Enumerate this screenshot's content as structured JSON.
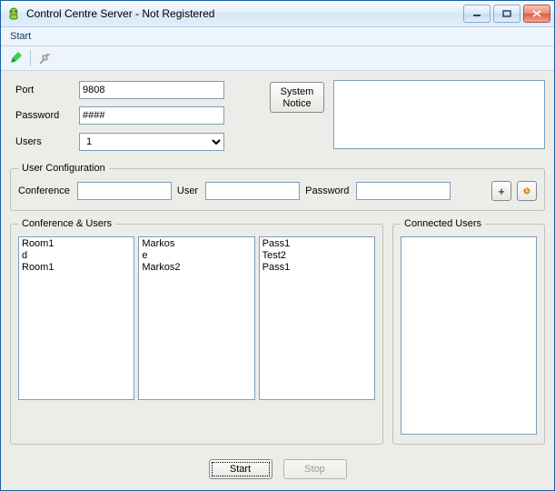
{
  "window": {
    "title": "Control Centre Server - Not Registered"
  },
  "menu": {
    "start": "Start"
  },
  "toolbar": {
    "connect_icon": "pen-icon",
    "disconnect_icon": "unplug-icon"
  },
  "settings": {
    "port_label": "Port",
    "port_value": "9808",
    "password_label": "Password",
    "password_value": "####",
    "users_label": "Users",
    "users_value": "1"
  },
  "system_notice": {
    "button_line1": "System",
    "button_line2": "Notice",
    "text": ""
  },
  "user_config": {
    "legend": "User Configuration",
    "conference_label": "Conference",
    "conference_value": "",
    "user_label": "User",
    "user_value": "",
    "password_label": "Password",
    "password_value": "",
    "add_label": "+"
  },
  "conference_users": {
    "legend": "Conference & Users",
    "conferences": [
      "Room1",
      "d",
      "Room1"
    ],
    "users": [
      "Markos",
      "e",
      "Markos2"
    ],
    "passwords": [
      "Pass1",
      "Test2",
      "Pass1"
    ]
  },
  "connected": {
    "legend": "Connected Users",
    "items": []
  },
  "buttons": {
    "start": "Start",
    "stop": "Stop"
  }
}
